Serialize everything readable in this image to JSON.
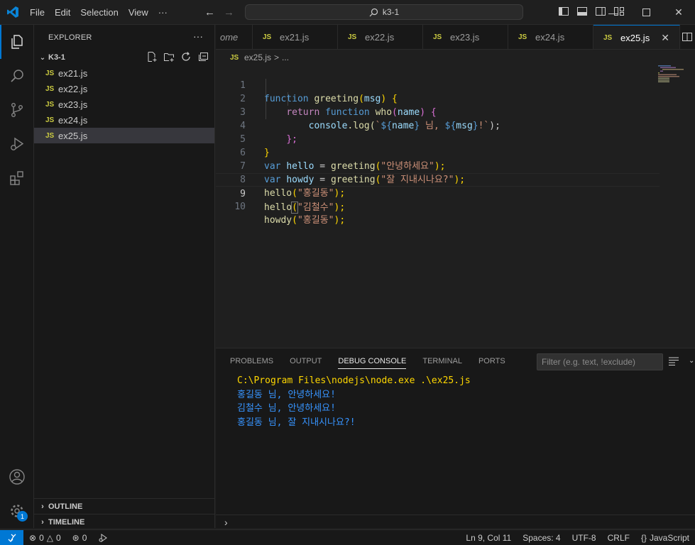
{
  "titlebar": {
    "menu": [
      "File",
      "Edit",
      "Selection",
      "View",
      "···"
    ],
    "search_text": "k3-1"
  },
  "sidebar": {
    "title": "EXPLORER",
    "folder": "K3-1",
    "files": [
      "ex21.js",
      "ex22.js",
      "ex23.js",
      "ex24.js",
      "ex25.js"
    ],
    "selected_file": "ex25.js",
    "outline_label": "OUTLINE",
    "timeline_label": "TIMELINE"
  },
  "tabs": {
    "partial_label": "ome",
    "items": [
      "ex21.js",
      "ex22.js",
      "ex23.js",
      "ex24.js",
      "ex25.js"
    ],
    "active": "ex25.js",
    "file_icon": "JS"
  },
  "breadcrumb": {
    "file": "ex25.js",
    "sep": ">",
    "more": "..."
  },
  "editor": {
    "line_numbers": [
      "1",
      "2",
      "3",
      "4",
      "5",
      "6",
      "7",
      "8",
      "9",
      "10"
    ],
    "current_line": 9,
    "lines": {
      "l1": [
        "function",
        "greeting",
        "(",
        "msg",
        ")",
        " {"
      ],
      "l2": [
        "return",
        "function",
        "who",
        "(",
        "name",
        ")",
        " {"
      ],
      "l3": [
        "console",
        ".log(",
        "`",
        "${",
        "name",
        "}",
        " 님, ",
        "${",
        "msg",
        "}",
        "!`",
        ");"
      ],
      "l4": [
        "};"
      ],
      "l5": [
        "}"
      ],
      "l6": [
        "var",
        "hello",
        " = ",
        "greeting",
        "(",
        "\"안녕하세요\"",
        ");"
      ],
      "l7": [
        "var",
        "howdy",
        " = ",
        "greeting",
        "(",
        "\"잘 지내시나요?\"",
        ");"
      ],
      "l8": [
        "hello",
        "(",
        "\"홍길동\"",
        ");"
      ],
      "l9": [
        "hello",
        "(",
        "\"김철수\"",
        ");"
      ],
      "l10": [
        "howdy",
        "(",
        "\"홍길동\"",
        ");"
      ]
    }
  },
  "panel": {
    "tabs": [
      "PROBLEMS",
      "OUTPUT",
      "DEBUG CONSOLE",
      "TERMINAL",
      "PORTS"
    ],
    "active_tab": "DEBUG CONSOLE",
    "filter_placeholder": "Filter (e.g. text, !exclude)",
    "console_command": "C:\\Program Files\\nodejs\\node.exe .\\ex25.js",
    "console_output": [
      "홍길동 님, 안녕하세요!",
      "김철수 님, 안녕하세요!",
      "홍길동 님, 잘 지내시나요?!"
    ]
  },
  "statusbar": {
    "errors": "0",
    "warnings": "0",
    "ports": "0",
    "position": "Ln 9, Col 11",
    "spaces": "Spaces: 4",
    "encoding": "UTF-8",
    "eol": "CRLF",
    "language_icon": "{}",
    "language": "JavaScript"
  },
  "activity_badge": "1",
  "colors": {
    "accent": "#0078d4",
    "keyword": "#569cd6",
    "function": "#dcdcaa",
    "string": "#ce9178",
    "output": "#3794ff"
  }
}
